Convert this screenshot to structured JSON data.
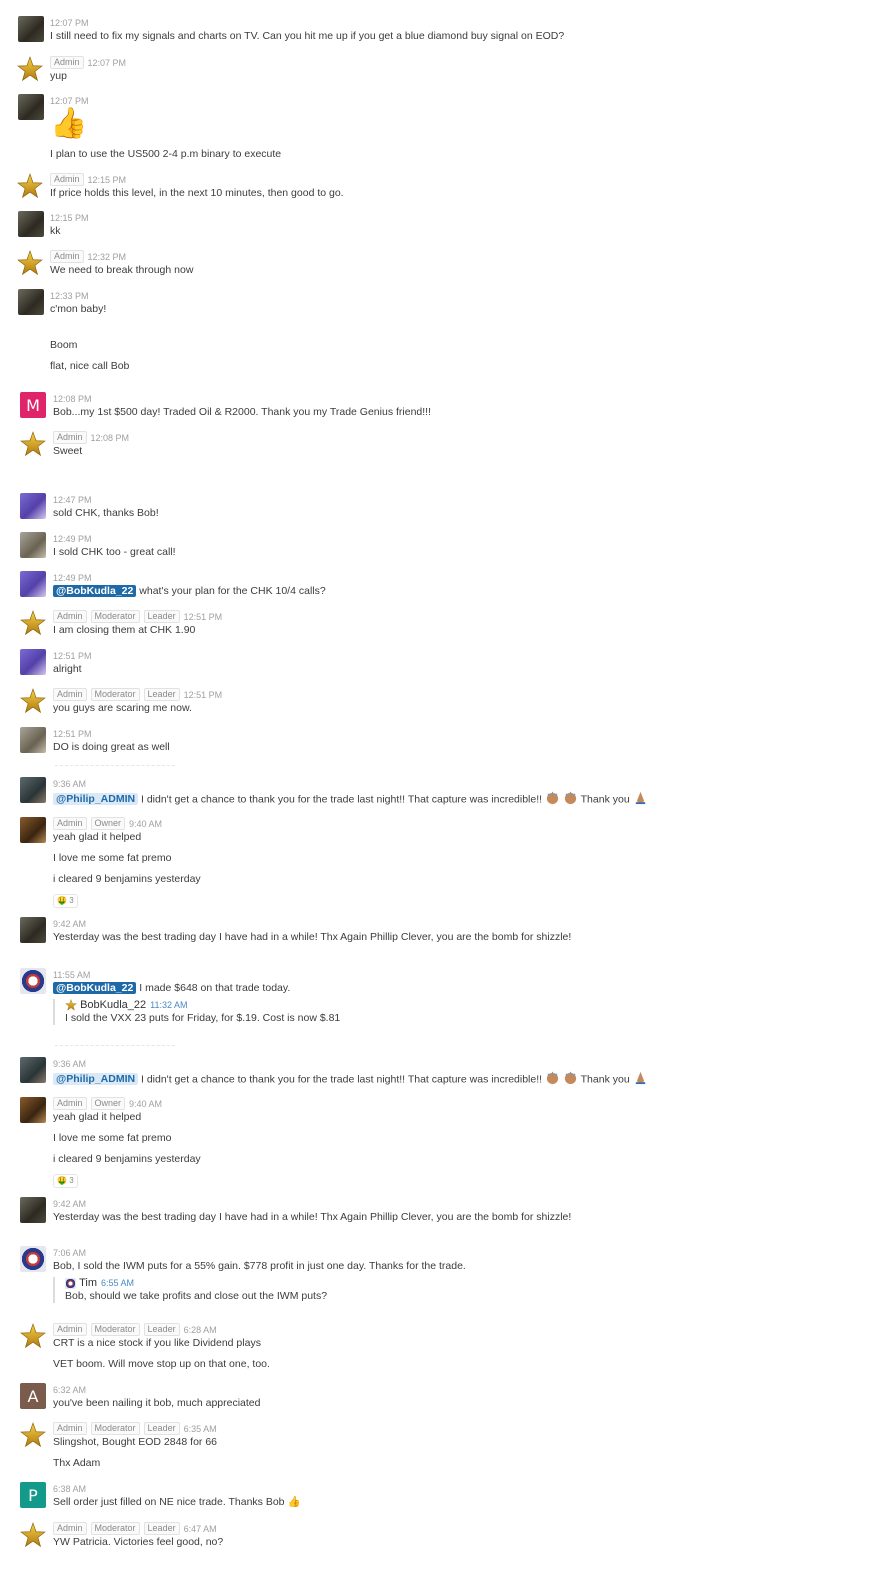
{
  "messages": [
    {
      "time": "12:07 PM",
      "badges": [],
      "lines": [
        "I still need to fix my signals and charts on TV. Can you hit me up if you get a blue diamond buy signal on EOD?"
      ]
    },
    {
      "time": "12:07 PM",
      "badges": [
        "Admin"
      ],
      "lines": [
        "yup"
      ]
    },
    {
      "time": "12:07 PM",
      "badges": [],
      "emoji": "👍",
      "lines": [
        "I plan to use the US500 2-4 p.m binary to execute"
      ]
    },
    {
      "time": "12:15 PM",
      "badges": [
        "Admin"
      ],
      "lines": [
        "If price holds this level, in the next 10 minutes, then good to go."
      ]
    },
    {
      "time": "12:15 PM",
      "badges": [],
      "lines": [
        "kk"
      ]
    },
    {
      "time": "12:32 PM",
      "badges": [
        "Admin"
      ],
      "lines": [
        "We need to break through now"
      ]
    },
    {
      "time": "12:33 PM",
      "badges": [],
      "lines": [
        "c'mon baby!",
        "Boom",
        "flat, nice call Bob"
      ]
    },
    {
      "time": "12:08 PM",
      "badges": [],
      "avatar_letter": "M",
      "lines": [
        "Bob...my 1st $500 day! Traded Oil & R2000. Thank you my Trade Genius friend!!!"
      ]
    },
    {
      "time": "12:08 PM",
      "badges": [
        "Admin"
      ],
      "lines": [
        "Sweet"
      ]
    },
    {
      "time": "12:47 PM",
      "badges": [],
      "lines": [
        "sold CHK, thanks Bob!"
      ]
    },
    {
      "time": "12:49 PM",
      "badges": [],
      "lines": [
        "I sold CHK too - great call!"
      ]
    },
    {
      "time": "12:49 PM",
      "badges": [],
      "mention": "@BobKudla_22",
      "lines": [
        "what's your plan for the CHK 10/4 calls?"
      ]
    },
    {
      "time": "12:51 PM",
      "badges": [
        "Admin",
        "Moderator",
        "Leader"
      ],
      "lines": [
        "I am closing them at CHK 1.90"
      ]
    },
    {
      "time": "12:51 PM",
      "badges": [],
      "lines": [
        "alright"
      ]
    },
    {
      "time": "12:51 PM",
      "badges": [
        "Admin",
        "Moderator",
        "Leader"
      ],
      "lines": [
        "you guys are scaring me now."
      ]
    },
    {
      "time": "12:51 PM",
      "badges": [],
      "lines": [
        "DO is doing great as well"
      ]
    },
    {
      "time": "9:36 AM",
      "badges": [],
      "mention": "@Philip_ADMIN",
      "lines": [
        "I didn't get a chance to thank you for the trade last night!! That capture was incredible!!"
      ],
      "tail": "Thank you"
    },
    {
      "time": "9:40 AM",
      "badges": [
        "Admin",
        "Owner"
      ],
      "lines": [
        "yeah glad it helped",
        "I love me some fat premo",
        "i cleared 9 benjamins yesterday"
      ],
      "reaction": {
        "emoji": "🤑",
        "count": "3"
      }
    },
    {
      "time": "9:42 AM",
      "badges": [],
      "lines": [
        "Yesterday was the best trading day I have had in a while! Thx Again Phillip Clever, you are the bomb for shizzle!"
      ]
    },
    {
      "time": "11:55 AM",
      "badges": [],
      "mention": "@BobKudla_22",
      "lines": [
        "I made $648 on that trade today."
      ],
      "quote": {
        "name": "BobKudla_22",
        "time": "11:32 AM",
        "text": "I sold the VXX 23 puts for Friday, for $.19. Cost is now $.81"
      }
    },
    {
      "time": "9:36 AM",
      "badges": [],
      "mention": "@Philip_ADMIN",
      "lines": [
        "I didn't get a chance to thank you for the trade last night!! That capture was incredible!!"
      ],
      "tail": "Thank you"
    },
    {
      "time": "9:40 AM",
      "badges": [
        "Admin",
        "Owner"
      ],
      "lines": [
        "yeah glad it helped",
        "I love me some fat premo",
        "i cleared 9 benjamins yesterday"
      ],
      "reaction": {
        "emoji": "🤑",
        "count": "3"
      }
    },
    {
      "time": "9:42 AM",
      "badges": [],
      "lines": [
        "Yesterday was the best trading day I have had in a while! Thx Again Phillip Clever, you are the bomb for shizzle!"
      ]
    },
    {
      "time": "7:06 AM",
      "badges": [],
      "lines": [
        "Bob, I sold the IWM puts for a 55% gain. $778 profit in just one day. Thanks for the trade."
      ],
      "quote": {
        "name": "Tim",
        "time": "6:55 AM",
        "text": "Bob, should we take profits and close out the IWM puts?"
      }
    },
    {
      "time": "6:28 AM",
      "badges": [
        "Admin",
        "Moderator",
        "Leader"
      ],
      "lines": [
        "CRT is a nice stock if you like Dividend plays",
        "VET boom. Will move stop up on that one, too."
      ]
    },
    {
      "time": "6:32 AM",
      "badges": [],
      "avatar_letter": "A",
      "lines": [
        "you've been nailing it bob, much appreciated"
      ]
    },
    {
      "time": "6:35 AM",
      "badges": [
        "Admin",
        "Moderator",
        "Leader"
      ],
      "lines": [
        "Slingshot, Bought EOD 2848 for 66",
        "Thx Adam"
      ]
    },
    {
      "time": "6:38 AM",
      "badges": [],
      "avatar_letter": "P",
      "lines": [
        "Sell order just filled on NE nice trade. Thanks Bob"
      ],
      "tail_emoji": "👍"
    },
    {
      "time": "6:47 AM",
      "badges": [
        "Admin",
        "Moderator",
        "Leader"
      ],
      "lines": [
        "YW Patricia. Victories feel good, no?"
      ]
    }
  ],
  "icons": {
    "star": "star-avatar-icon",
    "clap": "clap-emoji-icon",
    "pray": "pray-emoji-icon"
  },
  "colors": {
    "mention_bg": "#1e6aa8",
    "badge_border": "#e2e2e2",
    "time": "#a0a0a0",
    "avatar_m": "#e0246a",
    "avatar_a": "#7a5b4c",
    "avatar_p": "#139a8a",
    "star": "#d8a21a"
  }
}
